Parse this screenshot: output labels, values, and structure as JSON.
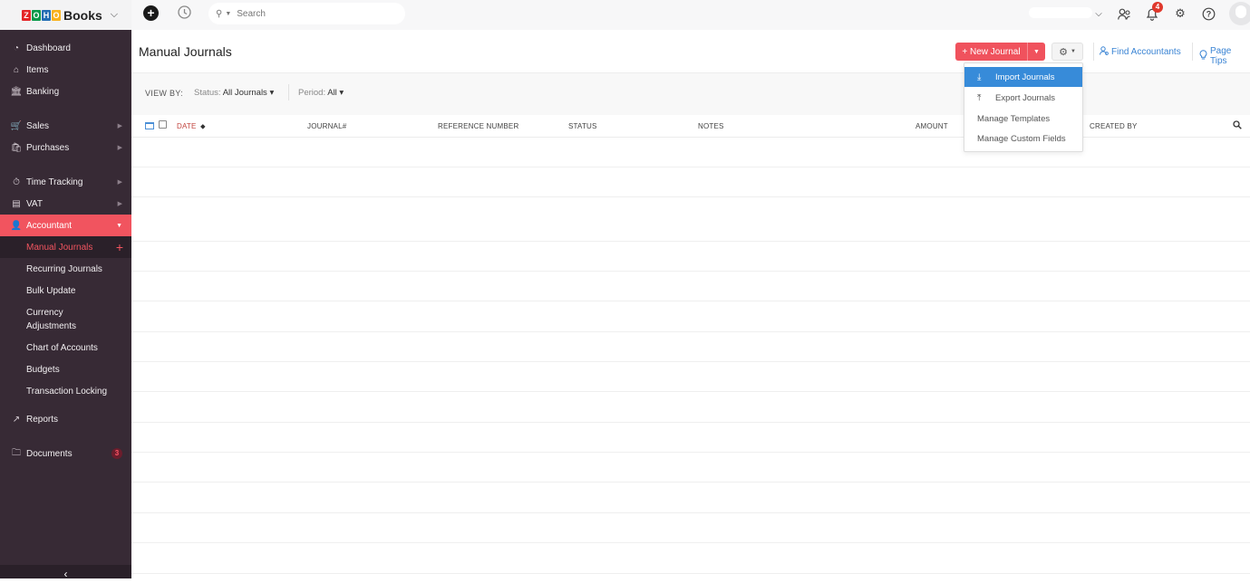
{
  "app": {
    "brand_letters": [
      "Z",
      "O",
      "H",
      "O"
    ],
    "brand_colors": [
      "#e42527",
      "#089949",
      "#226db4",
      "#f9b21d"
    ],
    "product": "Books",
    "chevron": "⌄"
  },
  "topbar": {
    "add_icon": "+",
    "history_icon": "🕘",
    "search_placeholder": "Search",
    "notification_count": "4",
    "icons": {
      "team": "👥",
      "bell": "🔔",
      "settings": "⚙",
      "help": "?"
    }
  },
  "sidebar": {
    "items": [
      {
        "label": "Dashboard",
        "icon": "◔"
      },
      {
        "label": "Items",
        "icon": "⌂"
      },
      {
        "label": "Banking",
        "icon": "🏛"
      },
      {
        "label": "Sales",
        "icon": "🛒",
        "arrow": "▶"
      },
      {
        "label": "Purchases",
        "icon": "🛍",
        "arrow": "▶"
      },
      {
        "label": "Time Tracking",
        "icon": "⏱",
        "arrow": "▶"
      },
      {
        "label": "VAT",
        "icon": "▤",
        "arrow": "▶"
      },
      {
        "label": "Accountant",
        "icon": "👤",
        "arrow": "▼"
      }
    ],
    "sub_items": [
      {
        "label": "Manual Journals",
        "action": "+"
      },
      {
        "label": "Recurring Journals"
      },
      {
        "label": "Bulk Update"
      },
      {
        "label": "Currency Adjustments",
        "line1": "Currency",
        "line2": "Adjustments"
      },
      {
        "label": "Chart of Accounts"
      },
      {
        "label": "Budgets"
      },
      {
        "label": "Transaction Locking"
      }
    ],
    "reports": {
      "label": "Reports",
      "icon": "↗"
    },
    "documents": {
      "label": "Documents",
      "icon": "🗀",
      "badge": "3"
    },
    "collapse_icon": "‹"
  },
  "header": {
    "title": "Manual Journals",
    "new_button": "+ New Journal",
    "new_dropdown": "▼",
    "gear_icon": "⚙",
    "gear_caret": "▼",
    "find_accountants": "Find Accountants",
    "find_icon": "👤",
    "page_tips": "Page Tips",
    "tips_icon": "💡"
  },
  "filters": {
    "view_by": "VIEW BY:",
    "status_label": "Status:",
    "status_value": "All Journals ▾",
    "period_label": "Period:",
    "period_value": "All ▾"
  },
  "table": {
    "columns": [
      "DATE",
      "JOURNAL#",
      "REFERENCE NUMBER",
      "STATUS",
      "NOTES",
      "AMOUNT",
      "CREATED BY"
    ],
    "sort_indicator": "⬥",
    "search_icon": "🔍",
    "rows": []
  },
  "settings_menu": {
    "items": [
      {
        "label": "Import Journals",
        "icon": "⤓",
        "highlighted": true
      },
      {
        "label": "Export Journals",
        "icon": "⤒"
      },
      {
        "label": "Manage Templates"
      },
      {
        "label": "Manage Custom Fields"
      }
    ]
  }
}
